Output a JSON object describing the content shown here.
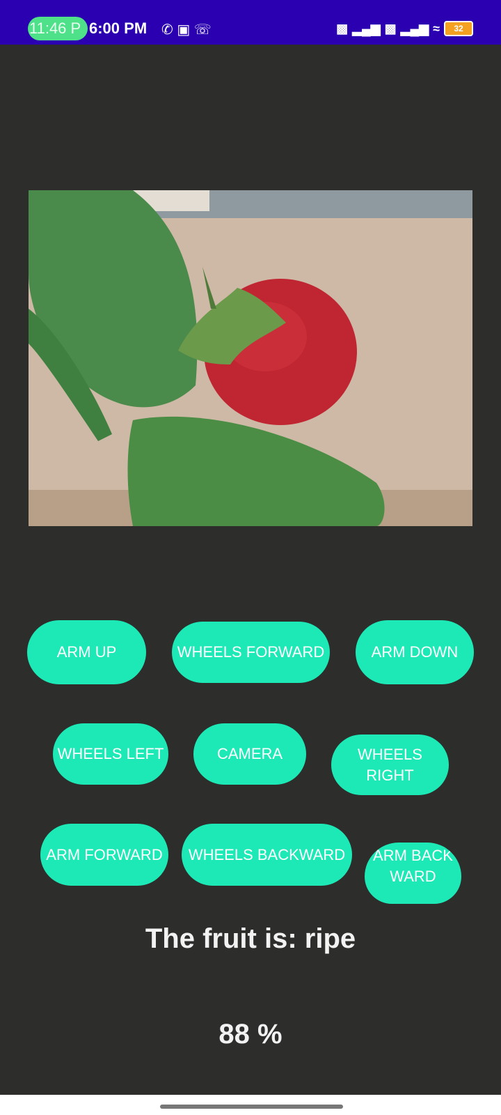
{
  "status_bar": {
    "recording_pill": "11:46 P",
    "time": "6:00 PM",
    "left_icons": [
      "whatsapp-icon",
      "screen-record-icon",
      "phone-icon"
    ],
    "right_icons": [
      "hd-icon",
      "signal-icon",
      "hd-icon",
      "signal-icon",
      "wifi-icon"
    ],
    "battery": "32",
    "background": "#2a00b0"
  },
  "image": {
    "subject": "strawberry-photo"
  },
  "buttons": [
    {
      "label": "ARM UP"
    },
    {
      "label": "WHEELS FORWARD"
    },
    {
      "label": "ARM DOWN"
    },
    {
      "label": "WHEELS LEFT"
    },
    {
      "label": "CAMERA"
    },
    {
      "label": "WHEELS RIGHT"
    },
    {
      "label": "ARM FORWARD"
    },
    {
      "label": "WHEELS BACKWARD"
    },
    {
      "label": "ARM BACKWARD"
    }
  ],
  "result": {
    "text": "The fruit is: ripe",
    "confidence": "88 %"
  },
  "colors": {
    "accent": "#1de9b6",
    "background": "#2d2d2b"
  }
}
